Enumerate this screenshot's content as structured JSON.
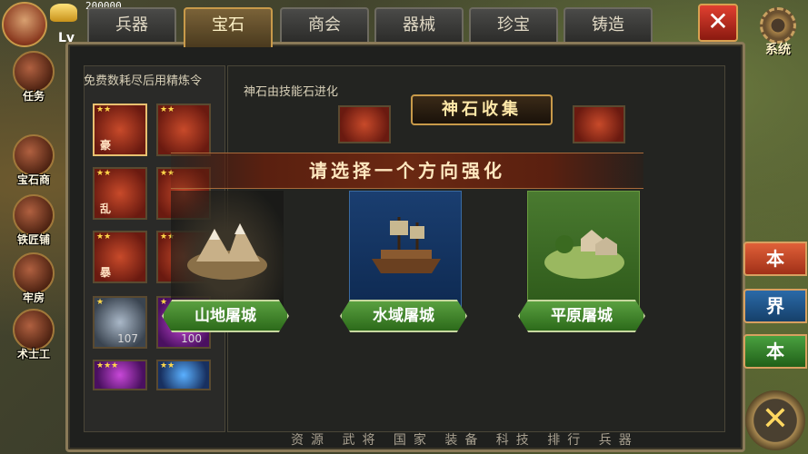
{
  "player": {
    "gold_display": "200000",
    "level_prefix": "Lv"
  },
  "tabs": [
    {
      "label": "兵器",
      "active": false
    },
    {
      "label": "宝石",
      "active": true
    },
    {
      "label": "商会",
      "active": false
    },
    {
      "label": "器械",
      "active": false
    },
    {
      "label": "珍宝",
      "active": false
    },
    {
      "label": "铸造",
      "active": false
    }
  ],
  "top_right": {
    "close_icon": "close-x-icon",
    "system_label": "系统"
  },
  "side_menu": [
    {
      "label": "任务",
      "icon": "quest-icon"
    },
    {
      "label": "宝石商",
      "icon": "gem-merchant-icon"
    },
    {
      "label": "铁匠铺",
      "icon": "blacksmith-icon"
    },
    {
      "label": "牢房",
      "icon": "prison-icon"
    },
    {
      "label": "术士工",
      "icon": "mage-icon"
    }
  ],
  "left_pane": {
    "title": "免费数耗尽后用精炼令",
    "gems": [
      {
        "glyph": "豪",
        "stars": "★★",
        "type": "ruby"
      },
      {
        "glyph": "乱",
        "stars": "★★",
        "type": "ruby"
      },
      {
        "glyph": "暴",
        "stars": "★★",
        "type": "ruby"
      },
      {
        "glyph": "",
        "stars": "★",
        "type": "diamond",
        "count": "107"
      },
      {
        "glyph": "",
        "stars": "★★★",
        "type": "purple"
      },
      {
        "glyph": "",
        "stars": "★★",
        "type": "ruby"
      },
      {
        "glyph": "",
        "stars": "★★",
        "type": "ruby"
      },
      {
        "glyph": "",
        "stars": "★★",
        "type": "ruby"
      },
      {
        "glyph": "",
        "stars": "★",
        "type": "purple",
        "count": "100"
      },
      {
        "glyph": "",
        "stars": "★★",
        "type": "blue"
      }
    ]
  },
  "right_pane": {
    "hint": "神石由技能石进化",
    "collect_title": "神石收集"
  },
  "dialog": {
    "title": "请选择一个方向强化",
    "options": [
      {
        "label": "山地屠城",
        "terrain": "mountain"
      },
      {
        "label": "水域屠城",
        "terrain": "water"
      },
      {
        "label": "平原屠城",
        "terrain": "plain"
      }
    ]
  },
  "bottom_tabs": "资源 武将 国家 装备 科技 排行 兵器",
  "right_side_buttons": [
    {
      "label": "本",
      "color": "#c04020"
    },
    {
      "label": "界",
      "color": "#1e5a96"
    },
    {
      "label": "本",
      "color": "#2e8a24"
    }
  ],
  "corner_close_icon": "close-x-icon"
}
